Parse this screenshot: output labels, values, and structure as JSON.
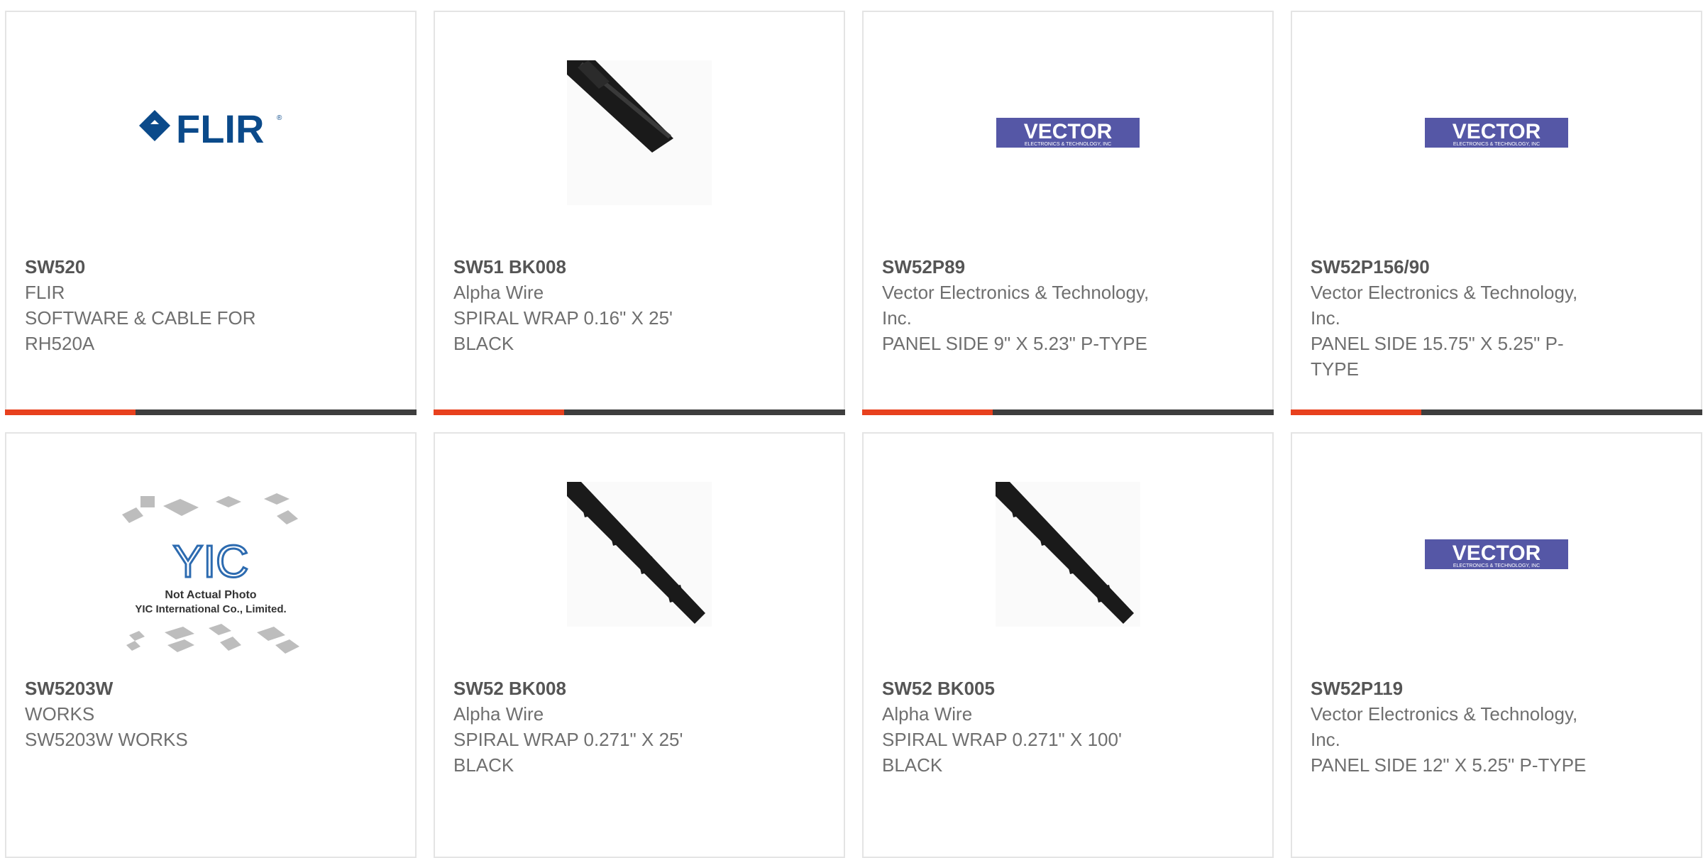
{
  "colors": {
    "accent": "#e8411e",
    "bar": "#3e3e3e",
    "text": "#6f6f6f",
    "flir_blue": "#0b4a8a",
    "vector_blue": "#5557a6"
  },
  "products": [
    {
      "part": "SW520",
      "manufacturer": "FLIR",
      "desc_line1": "SOFTWARE & CABLE FOR",
      "desc_line2": "RH520A",
      "image": "flir-logo"
    },
    {
      "part": "SW51 BK008",
      "manufacturer": "Alpha Wire",
      "desc_line1": "SPIRAL WRAP 0.16\" X 25'",
      "desc_line2": "BLACK",
      "image": "spiral-wrap-photo"
    },
    {
      "part": "SW52P89",
      "manufacturer_line1": "Vector Electronics & Technology,",
      "manufacturer_line2": "Inc.",
      "desc_line1": "PANEL SIDE 9\" X 5.23\" P-TYPE",
      "image": "vector-logo"
    },
    {
      "part": "SW52P156/90",
      "manufacturer_line1": "Vector Electronics & Technology,",
      "manufacturer_line2": "Inc.",
      "desc_line1": "PANEL SIDE 15.75\" X 5.25\" P-",
      "desc_line2": "TYPE",
      "image": "vector-logo"
    },
    {
      "part": "SW5203W",
      "manufacturer": "WORKS",
      "desc_line1": "SW5203W WORKS",
      "image": "not-actual-photo"
    },
    {
      "part": "SW52 BK008",
      "manufacturer": "Alpha Wire",
      "desc_line1": "SPIRAL WRAP 0.271\" X 25'",
      "desc_line2": "BLACK",
      "image": "spiral-wrap-photo"
    },
    {
      "part": "SW52 BK005",
      "manufacturer": "Alpha Wire",
      "desc_line1": "SPIRAL WRAP 0.271\" X 100'",
      "desc_line2": "BLACK",
      "image": "spiral-wrap-photo"
    },
    {
      "part": "SW52P119",
      "manufacturer_line1": "Vector Electronics & Technology,",
      "manufacturer_line2": "Inc.",
      "desc_line1": "PANEL SIDE 12\" X 5.25\" P-TYPE",
      "image": "vector-logo"
    }
  ],
  "logos": {
    "flir": "FLIR",
    "vector": "VECTOR",
    "vector_sub": "ELECTRONICS & TECHNOLOGY, INC",
    "yic": "YIC",
    "yic_line1": "Not Actual Photo",
    "yic_line2": "YIC International Co., Limited."
  }
}
